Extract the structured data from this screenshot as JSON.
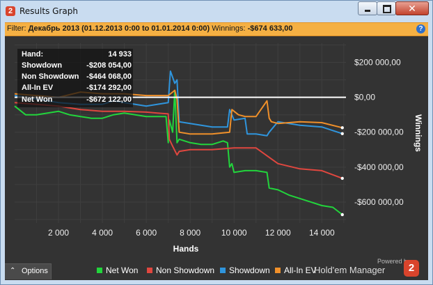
{
  "window": {
    "title": "Results Graph",
    "app_icon": "2"
  },
  "filter": {
    "prefix": "Filter:",
    "range": "Декабрь 2013 (01.12.2013 0:00 to 01.01.2014 0:00)",
    "winnings_label": "Winnings:",
    "winnings_value": "-$674 633,00",
    "help": "?"
  },
  "stats": {
    "hand_label": "Hand:",
    "hand_value": "14 933",
    "showdown_label": "Showdown",
    "showdown_value": "-$208 054,00",
    "non_showdown_label": "Non Showdown",
    "non_showdown_value": "-$464 068,00",
    "allin_label": "All-In EV",
    "allin_value": "-$174 292,00",
    "netwon_label": "Net Won",
    "netwon_value": "-$672 122,00"
  },
  "options": {
    "label": "Options"
  },
  "branding": {
    "powered": "Powered by",
    "name": "Hold'em Manager",
    "logo": "2"
  },
  "colors": {
    "net_won": "#22d53c",
    "non_showdown": "#e0473f",
    "showdown": "#2f95dd",
    "allin_ev": "#f0902a",
    "panel": "#333333",
    "zero_line": "#ffffff"
  },
  "chart_data": {
    "type": "line",
    "xlabel": "Hands",
    "ylabel": "Winnings",
    "xlim": [
      0,
      15100
    ],
    "ylim": [
      -720000,
      310000
    ],
    "x_ticks": [
      2000,
      4000,
      6000,
      8000,
      10000,
      12000,
      14000
    ],
    "x_tick_labels": [
      "2 000",
      "4 000",
      "6 000",
      "8 000",
      "10 000",
      "12 000",
      "14 000"
    ],
    "y_ticks": [
      200000,
      0,
      -200000,
      -400000,
      -600000
    ],
    "y_tick_labels": [
      "$200 000,00",
      "$0,00",
      "-$200 000,00",
      "-$400 000,00",
      "-$600 000,00"
    ],
    "zero_line": 0,
    "legend_position": "bottom",
    "series": [
      {
        "name": "Net Won",
        "color": "#22d53c",
        "x": [
          0,
          500,
          1000,
          1500,
          2000,
          2500,
          3000,
          3500,
          4000,
          4500,
          5000,
          5500,
          6000,
          6500,
          6900,
          7000,
          7050,
          7200,
          7300,
          7400,
          7500,
          8000,
          8500,
          9000,
          9500,
          9700,
          9800,
          9900,
          10000,
          10500,
          11000,
          11500,
          11600,
          12000,
          12500,
          13000,
          13500,
          14000,
          14500,
          14933
        ],
        "y": [
          -50000,
          -100000,
          -100000,
          -90000,
          -80000,
          -100000,
          -110000,
          -120000,
          -120000,
          -100000,
          -90000,
          -100000,
          -110000,
          -110000,
          -110000,
          -260000,
          -130000,
          -200000,
          40000,
          -260000,
          -240000,
          -260000,
          -270000,
          -270000,
          -250000,
          -260000,
          -400000,
          -380000,
          -430000,
          -420000,
          -420000,
          -430000,
          -520000,
          -530000,
          -560000,
          -580000,
          -600000,
          -620000,
          -630000,
          -672122
        ]
      },
      {
        "name": "Non Showdown",
        "color": "#e0473f",
        "x": [
          0,
          1000,
          2000,
          3000,
          4000,
          5000,
          6000,
          6500,
          7000,
          7050,
          7200,
          7400,
          7500,
          8000,
          9000,
          10000,
          11000,
          12000,
          13000,
          14000,
          14933
        ],
        "y": [
          -30000,
          -40000,
          -50000,
          -70000,
          -80000,
          -80000,
          -85000,
          -90000,
          -95000,
          -240000,
          -280000,
          -330000,
          -310000,
          -300000,
          -300000,
          -290000,
          -290000,
          -380000,
          -410000,
          -420000,
          -464068
        ]
      },
      {
        "name": "Showdown",
        "color": "#2f95dd",
        "x": [
          0,
          1000,
          2000,
          3000,
          4000,
          4500,
          5000,
          6000,
          6500,
          7000,
          7100,
          7300,
          7400,
          7500,
          8000,
          9000,
          9700,
          9800,
          10000,
          10500,
          10600,
          11000,
          11500,
          11600,
          12000,
          13000,
          14000,
          14933
        ],
        "y": [
          10000,
          -10000,
          -30000,
          -40000,
          -40000,
          -20000,
          -30000,
          -50000,
          -40000,
          -30000,
          150000,
          80000,
          100000,
          -140000,
          -150000,
          -170000,
          -170000,
          -70000,
          -130000,
          -120000,
          -210000,
          -210000,
          -220000,
          -200000,
          -140000,
          -160000,
          -170000,
          -208054
        ]
      },
      {
        "name": "All-In EV",
        "color": "#f0902a",
        "x": [
          0,
          1000,
          2000,
          3000,
          4000,
          5000,
          6000,
          7000,
          7200,
          7300,
          7400,
          7500,
          8000,
          9000,
          9800,
          9900,
          10200,
          10500,
          11000,
          11500,
          11600,
          11700,
          12000,
          13000,
          14000,
          14933
        ],
        "y": [
          20000,
          10000,
          0,
          30000,
          20000,
          20000,
          10000,
          10000,
          30000,
          40000,
          -10000,
          -200000,
          -210000,
          -210000,
          -200000,
          -70000,
          -100000,
          -110000,
          -110000,
          -20000,
          -120000,
          -140000,
          -150000,
          -140000,
          -145000,
          -174292
        ]
      }
    ]
  }
}
